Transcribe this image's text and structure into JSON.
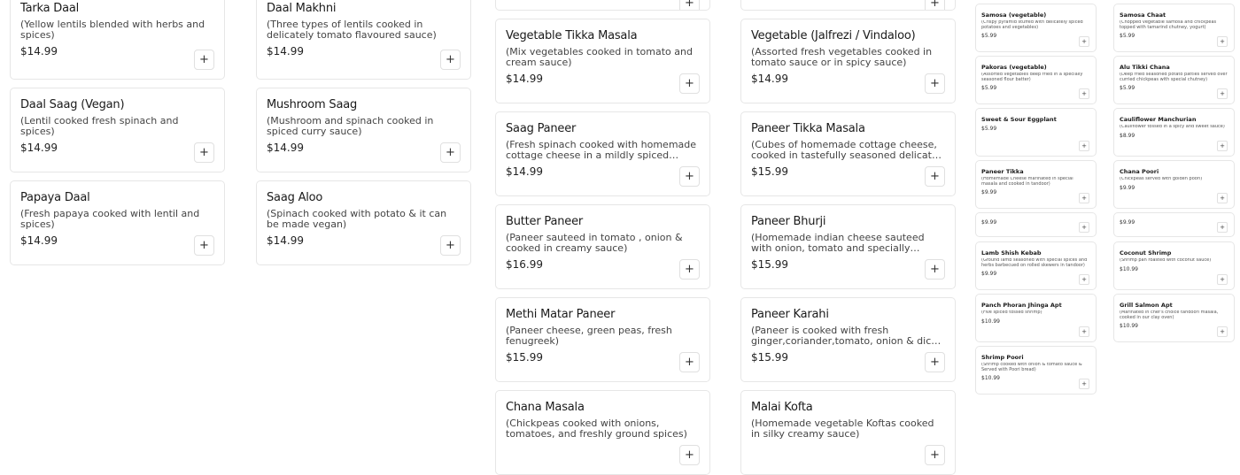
{
  "add_icon": "+",
  "col1": [
    {
      "name": "Tarka Daal",
      "desc": "(Yellow lentils blended with herbs and spices)",
      "price": "$14.99"
    },
    {
      "name": "Daal Saag (Vegan)",
      "desc": "(Lentil cooked fresh spinach and spices)",
      "price": "$14.99"
    },
    {
      "name": "Papaya Daal",
      "desc": "(Fresh papaya cooked with lentil and spices)",
      "price": "$14.99"
    }
  ],
  "col2": [
    {
      "name": "Daal Makhni",
      "desc": "(Three types of lentils cooked in delicately tomato flavoured sauce)",
      "price": "$14.99"
    },
    {
      "name": "Mushroom Saag",
      "desc": "(Mushroom and spinach cooked in spiced curry sauce)",
      "price": "$14.99"
    },
    {
      "name": "Saag Aloo",
      "desc": "(Spinach cooked with potato & it can be made vegan)",
      "price": "$14.99"
    }
  ],
  "col3": [
    {
      "name": "Vegetable Tikka Masala",
      "desc": "(Mix vegetables cooked in tomato and cream sauce)",
      "price": "$14.99"
    },
    {
      "name": "Saag Paneer",
      "desc": "(Fresh spinach cooked with homemade cottage cheese in a mildly spiced cream sauce)",
      "price": "$14.99"
    },
    {
      "name": "Butter Paneer",
      "desc": "(Paneer sauteed in tomato , onion & cooked in creamy sauce)",
      "price": "$16.99"
    },
    {
      "name": "Methi Matar Paneer",
      "desc": "(Paneer cheese, green peas, fresh fenugreek)",
      "price": "$15.99"
    },
    {
      "name": "Chana Masala",
      "desc": "(Chickpeas cooked with onions, tomatoes, and freshly ground spices)",
      "price": ""
    }
  ],
  "col4": [
    {
      "name": "Vegetable (Jalfrezi / Vindaloo)",
      "desc": "(Assorted fresh vegetables cooked in tomato sauce or in spicy sauce)",
      "price": "$14.99"
    },
    {
      "name": "Paneer Tikka Masala",
      "desc": "(Cubes of homemade cottage cheese, cooked in tastefully seasoned delicate sauce)",
      "price": "$15.99"
    },
    {
      "name": "Paneer Bhurji",
      "desc": "(Homemade indian cheese sauteed with onion, tomato and specially imported spices)",
      "price": "$15.99"
    },
    {
      "name": "Paneer Karahi",
      "desc": "(Paneer is cooked with fresh ginger,coriander,tomato, onion & diced peppers)",
      "price": "$15.99"
    },
    {
      "name": "Malai Kofta",
      "desc": "(Homemade vegetable Koftas cooked in silky creamy sauce)",
      "price": ""
    }
  ],
  "col5": [
    {
      "name": "Samosa (vegetable)",
      "desc": "(Crispy pyramid stuffed with delicately spiced potatoes and vegetables)",
      "price": "$5.99"
    },
    {
      "name": "Pakoras (vegetable)",
      "desc": "(Assorted vegetables deep fried in a specially seasoned flour batter)",
      "price": "$5.99"
    },
    {
      "name": "Sweet & Sour Eggplant",
      "desc": "",
      "price": "$5.99"
    },
    {
      "name": "Paneer Tikka",
      "desc": "(Homemade Cheese marinated in special masala and cooked in tandoor)",
      "price": "$9.99"
    },
    {
      "name": "",
      "desc": "",
      "price": "$9.99"
    },
    {
      "name": "Lamb Shish Kebab",
      "desc": "(Ground lamb seasoned with special spices and herbs barbecued on rolled skewers in tandoor)",
      "price": "$9.99"
    },
    {
      "name": "Panch Phoran Jhinga Apt",
      "desc": "(Five spiced tossed shrimp)",
      "price": "$10.99"
    },
    {
      "name": "Shrimp Poori",
      "desc": "(Shrimp cooked with onion & tomato sauce & Served with Poori bread)",
      "price": "$10.99"
    }
  ],
  "col6": [
    {
      "name": "Samosa Chaat",
      "desc": "(Chopped vegetable samosa and chickpeas topped with tamarind chutney, yogurt)",
      "price": "$5.99"
    },
    {
      "name": "Alu Tikki Chana",
      "desc": "(Deep fried seasoned potato patties served over curried chickpeas with special chutney)",
      "price": "$5.99"
    },
    {
      "name": "Cauliflower Manchurian",
      "desc": "(Cauliflower tossed in a spicy and sweet sauce)",
      "price": "$8.99"
    },
    {
      "name": "Chana Poori",
      "desc": "(Chickpeas served with golden poori)",
      "price": "$9.99"
    },
    {
      "name": "",
      "desc": "",
      "price": "$9.99"
    },
    {
      "name": "Coconut Shrimp",
      "desc": "(Shrimp pan roasted with coconut sauce)",
      "price": "$10.99"
    },
    {
      "name": "Grill Salmon Apt",
      "desc": "(Marinated in chef's choice tandoori masala, cooked in our clay oven)",
      "price": "$10.99"
    }
  ]
}
